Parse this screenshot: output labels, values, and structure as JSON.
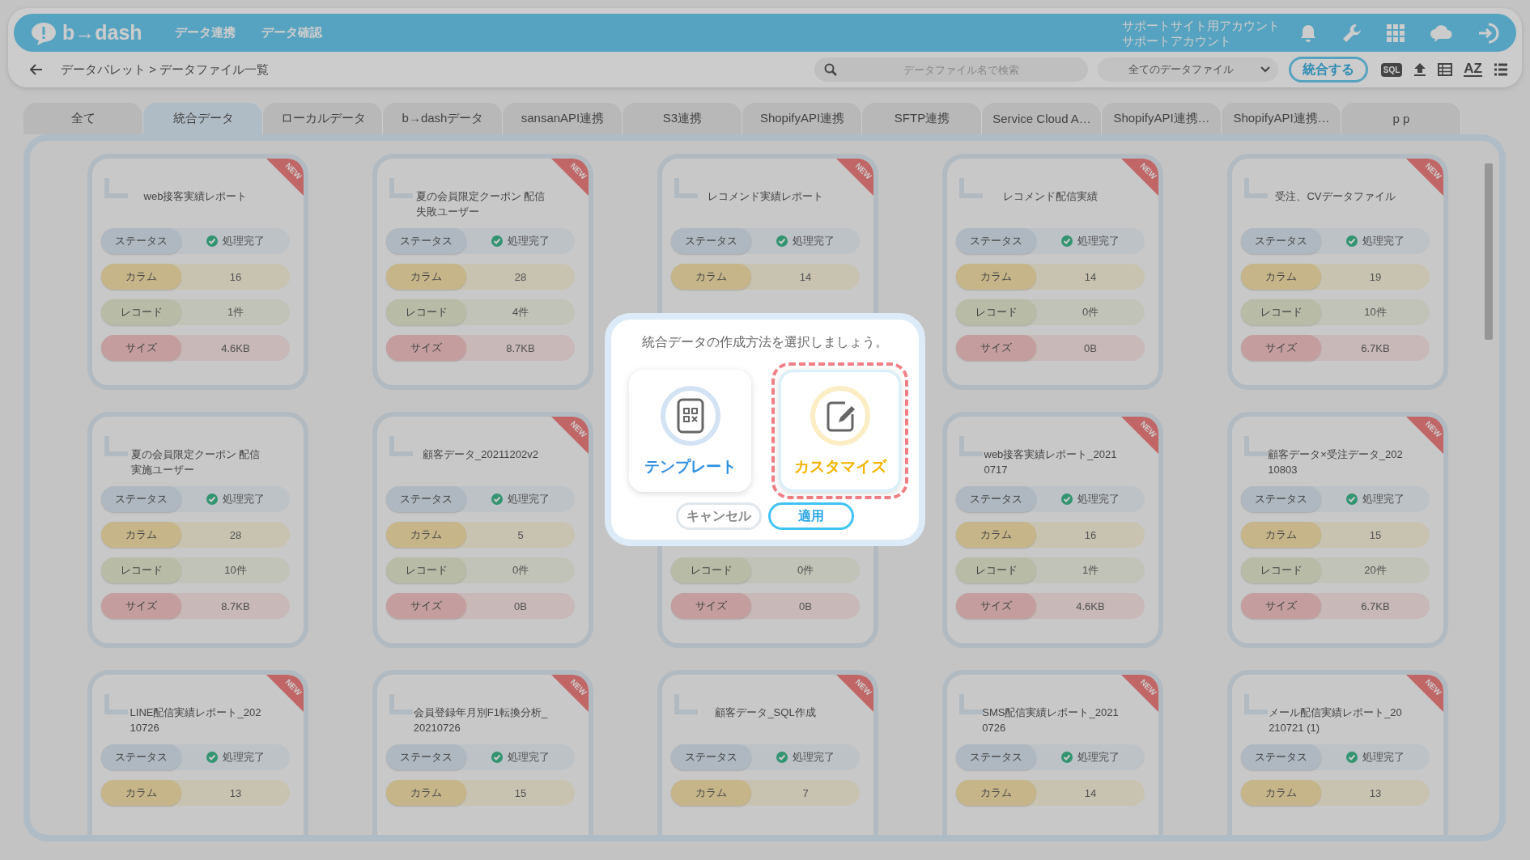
{
  "header": {
    "logo": "b→dash",
    "nav": [
      "データ連携",
      "データ確認"
    ],
    "account": [
      "サポートサイト用アカウント",
      "サポートアカウント"
    ]
  },
  "subbar": {
    "breadcrumb": "データパレット > データファイル一覧",
    "search": {
      "placeholder": "データファイル名で検索"
    },
    "filter": "全てのデータファイル",
    "merge_button": "統合する",
    "sql_label": "SQL",
    "sort_label": "AZ"
  },
  "tabs": [
    {
      "label": "全て",
      "selected": false
    },
    {
      "label": "統合データ",
      "selected": true
    },
    {
      "label": "ローカルデータ",
      "selected": false
    },
    {
      "label": "b→dashデータ",
      "selected": false
    },
    {
      "label": "sansanAPI連携",
      "selected": false
    },
    {
      "label": "S3連携",
      "selected": false
    },
    {
      "label": "ShopifyAPI連携",
      "selected": false
    },
    {
      "label": "SFTP連携",
      "selected": false
    },
    {
      "label": "Service Cloud A…",
      "selected": false
    },
    {
      "label": "ShopifyAPI連携…",
      "selected": false
    },
    {
      "label": "ShopifyAPI連携…",
      "selected": false
    },
    {
      "label": "p p",
      "selected": false
    }
  ],
  "cards": [
    {
      "badge": "NEW",
      "title": "web接客実績レポート",
      "rows": [
        {
          "kind": "status",
          "label": "ステータス",
          "value": "処理完了"
        },
        {
          "kind": "column",
          "label": "カラム",
          "value": "16"
        },
        {
          "kind": "record",
          "label": "レコード",
          "value": "1件"
        },
        {
          "kind": "size",
          "label": "サイズ",
          "value": "4.6KB"
        }
      ]
    },
    {
      "badge": "NEW",
      "title": [
        "夏の会員限定クーポン 配信",
        "失敗ユーザー"
      ],
      "rows": [
        {
          "kind": "status",
          "label": "ステータス",
          "value": "処理完了"
        },
        {
          "kind": "column",
          "label": "カラム",
          "value": "28"
        },
        {
          "kind": "record",
          "label": "レコード",
          "value": "4件"
        },
        {
          "kind": "size",
          "label": "サイズ",
          "value": "8.7KB"
        }
      ]
    },
    {
      "badge": "NEW",
      "title": "レコメンド実績レポート",
      "rows": [
        {
          "kind": "status",
          "label": "ステータス",
          "value": "処理完了"
        },
        {
          "kind": "column",
          "label": "カラム",
          "value": "14"
        }
      ]
    },
    {
      "badge": "NEW",
      "title": "レコメンド配信実績",
      "rows": [
        {
          "kind": "status",
          "label": "ステータス",
          "value": "処理完了"
        },
        {
          "kind": "column",
          "label": "カラム",
          "value": "14"
        },
        {
          "kind": "record",
          "label": "レコード",
          "value": "0件"
        },
        {
          "kind": "size",
          "label": "サイズ",
          "value": "0B"
        }
      ]
    },
    {
      "badge": "NEW",
      "title": "受注、CVデータファイル",
      "rows": [
        {
          "kind": "status",
          "label": "ステータス",
          "value": "処理完了"
        },
        {
          "kind": "column",
          "label": "カラム",
          "value": "19"
        },
        {
          "kind": "record",
          "label": "レコード",
          "value": "10件"
        },
        {
          "kind": "size",
          "label": "サイズ",
          "value": "6.7KB"
        }
      ]
    },
    {
      "title": [
        "夏の会員限定クーポン 配信",
        "実施ユーザー"
      ],
      "rows": [
        {
          "kind": "status",
          "label": "ステータス",
          "value": "処理完了"
        },
        {
          "kind": "column",
          "label": "カラム",
          "value": "28"
        },
        {
          "kind": "record",
          "label": "レコード",
          "value": "10件"
        },
        {
          "kind": "size",
          "label": "サイズ",
          "value": "8.7KB"
        }
      ]
    },
    {
      "badge": "NEW",
      "title": "顧客データ_20211202v2",
      "rows": [
        {
          "kind": "status",
          "label": "ステータス",
          "value": "処理完了"
        },
        {
          "kind": "column",
          "label": "カラム",
          "value": "5"
        },
        {
          "kind": "record",
          "label": "レコード",
          "value": "0件"
        },
        {
          "kind": "size",
          "label": "サイズ",
          "value": "0B"
        }
      ]
    },
    {
      "rows": [
        {
          "kind": "record",
          "label": "レコード",
          "value": "0件"
        },
        {
          "kind": "size",
          "label": "サイズ",
          "value": "0B"
        }
      ]
    },
    {
      "badge": "NEW",
      "title": [
        "web接客実績レポート_2021",
        "0717"
      ],
      "rows": [
        {
          "kind": "status",
          "label": "ステータス",
          "value": "処理完了"
        },
        {
          "kind": "column",
          "label": "カラム",
          "value": "16"
        },
        {
          "kind": "record",
          "label": "レコード",
          "value": "1件"
        },
        {
          "kind": "size",
          "label": "サイズ",
          "value": "4.6KB"
        }
      ]
    },
    {
      "badge": "NEW",
      "title": [
        "顧客データ×受注データ_202",
        "10803"
      ],
      "rows": [
        {
          "kind": "status",
          "label": "ステータス",
          "value": "処理完了"
        },
        {
          "kind": "column",
          "label": "カラム",
          "value": "15"
        },
        {
          "kind": "record",
          "label": "レコード",
          "value": "20件"
        },
        {
          "kind": "size",
          "label": "サイズ",
          "value": "6.7KB"
        }
      ]
    },
    {
      "badge": "NEW",
      "title": [
        "LINE配信実績レポート_202",
        "10726"
      ],
      "rows": [
        {
          "kind": "status",
          "label": "ステータス",
          "value": "処理完了"
        },
        {
          "kind": "column",
          "label": "カラム",
          "value": "13"
        }
      ]
    },
    {
      "badge": "NEW",
      "title": [
        "会員登録年月別F1転換分析_",
        "20210726"
      ],
      "rows": [
        {
          "kind": "status",
          "label": "ステータス",
          "value": "処理完了"
        },
        {
          "kind": "column",
          "label": "カラム",
          "value": "15"
        }
      ]
    },
    {
      "badge": "NEW",
      "title": "顧客データ_SQL作成",
      "rows": [
        {
          "kind": "status",
          "label": "ステータス",
          "value": "処理完了"
        },
        {
          "kind": "column",
          "label": "カラム",
          "value": "7"
        }
      ]
    },
    {
      "badge": "NEW",
      "title": [
        "SMS配信実績レポート_2021",
        "0726"
      ],
      "rows": [
        {
          "kind": "status",
          "label": "ステータス",
          "value": "処理完了"
        },
        {
          "kind": "column",
          "label": "カラム",
          "value": "14"
        }
      ]
    },
    {
      "badge": "NEW",
      "title": [
        "メール配信実績レポート_20",
        "210721 (1)"
      ],
      "rows": [
        {
          "kind": "status",
          "label": "ステータス",
          "value": "処理完了"
        },
        {
          "kind": "column",
          "label": "カラム",
          "value": "13"
        }
      ]
    }
  ],
  "dialog": {
    "message": "統合データの作成方法を選択しましょう。",
    "options": [
      {
        "kind": "template",
        "label": "テンプレート",
        "selected": false
      },
      {
        "kind": "custom",
        "label": "カスタマイズ",
        "selected": true
      }
    ],
    "buttons": [
      {
        "kind": "cancel",
        "label": "キャンセル"
      },
      {
        "kind": "apply",
        "label": "適用"
      }
    ]
  }
}
